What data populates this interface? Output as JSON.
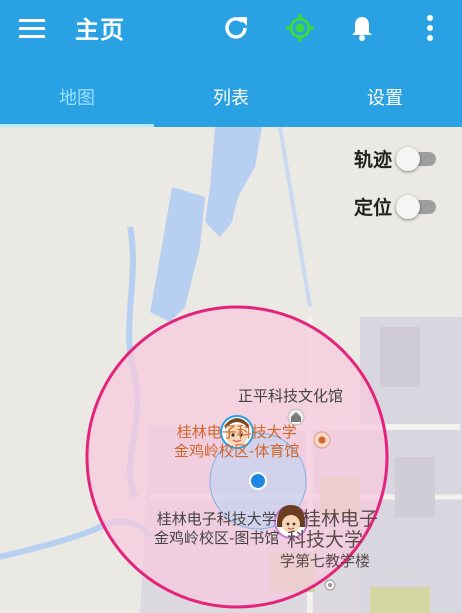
{
  "toolbar": {
    "title": "主页",
    "icons": [
      "menu-icon",
      "refresh-icon",
      "locate-icon",
      "bell-icon",
      "more-icon"
    ],
    "locate_color": "#3ddc3d"
  },
  "tabs": [
    {
      "label": "地图",
      "active": true
    },
    {
      "label": "列表",
      "active": false
    },
    {
      "label": "设置",
      "active": false
    }
  ],
  "map": {
    "toggles": [
      {
        "label": "轨迹",
        "on": false
      },
      {
        "label": "定位",
        "on": false
      }
    ],
    "pois": {
      "culture_hall": "正平科技文化馆",
      "gym_line1": "桂林电子科技大学",
      "gym_line2": "金鸡岭校区-体育馆",
      "library_line1": "桂林电子科技大学",
      "library_line2": "金鸡岭校区-图书馆",
      "building_line1": "桂林电子",
      "building_line2": "科技大学",
      "building_line3": "学第七教学楼"
    },
    "colors": {
      "geofence_stroke": "#e3247a",
      "geofence_fill": "#f7c9dd",
      "water": "#b7cff0",
      "location_dot": "#1e88e5"
    }
  }
}
